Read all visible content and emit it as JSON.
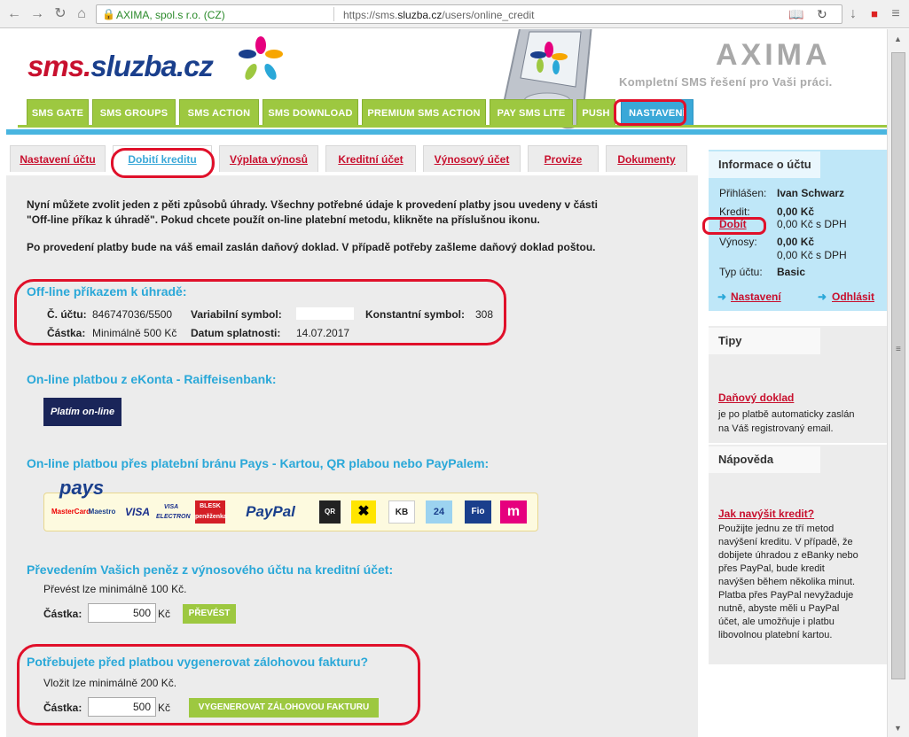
{
  "browser": {
    "org": "AXIMA, spol.s r.o. (CZ)",
    "url_prefix": "https://sms.",
    "url_domain": "sluzba.cz",
    "url_path": "/users/online_credit"
  },
  "header": {
    "logo_part1": "sms.",
    "logo_part2": "sluzba.cz",
    "brand": "AXIMA",
    "slogan": "Kompletní SMS řešení pro Vaši práci."
  },
  "nav": {
    "tabs": [
      "SMS GATE",
      "SMS GROUPS",
      "SMS ACTION",
      "SMS DOWNLOAD",
      "PREMIUM SMS ACTION",
      "PAY SMS LITE",
      "PUSH",
      "NASTAVENÍ"
    ],
    "active": "NASTAVENÍ"
  },
  "subnav": {
    "tabs": [
      "Nastavení účtu",
      "Dobití kreditu",
      "Výplata výnosů",
      "Kreditní účet",
      "Výnosový účet",
      "Provize",
      "Dokumenty"
    ],
    "active": "Dobití kreditu"
  },
  "main": {
    "intro1": "Nyní můžete zvolit jeden z pěti způsobů úhrady. Všechny potřebné údaje k provedení platby jsou uvedeny v části",
    "intro2": "\"Off-line příkaz k úhradě\". Pokud chcete použít on-line platební metodu, klikněte na příslušnou ikonu.",
    "intro3": "Po provedení platby bude na váš email zaslán daňový doklad. V případě potřeby zašleme daňový doklad poštou.",
    "offline": {
      "title": "Off-line příkazem k úhradě:",
      "account_label": "Č. účtu:",
      "account_value": "846747036/5500",
      "vs_label": "Variabilní symbol:",
      "ks_label": "Konstantní symbol:",
      "ks_value": "308",
      "amount_label": "Částka:",
      "amount_value": "Minimálně 500 Kč",
      "due_label": "Datum splatnosti:",
      "due_value": "14.07.2017"
    },
    "ekonto": {
      "title": "On-line platbou z eKonta - Raiffeisenbank:",
      "button": "Platím on-line"
    },
    "pays": {
      "title": "On-line platbou přes platební bránu Pays - Kartou, QR plabou nebo PayPalem:",
      "logo": "pays",
      "methods": [
        "MasterCard",
        "Maestro",
        "VISA",
        "VISA ELECTRON",
        "BLESK peněženka",
        "PayPal",
        "QR",
        "Raiffeisen",
        "KB",
        "24",
        "Fio",
        "m"
      ]
    },
    "transfer": {
      "title": "Převedením Vašich peněz z výnosového účtu na kreditní účet:",
      "note": "Převést lze minimálně 100 Kč.",
      "amount_label": "Částka:",
      "amount_value": "500",
      "currency": "Kč",
      "button": "PŘEVÉST"
    },
    "invoice": {
      "title": "Potřebujete před platbou vygenerovat zálohovou fakturu?",
      "note": "Vložit lze minimálně 200 Kč.",
      "amount_label": "Částka:",
      "amount_value": "500",
      "currency": "Kč",
      "button": "VYGENEROVAT ZÁLOHOVOU FAKTURU"
    }
  },
  "sidebar": {
    "info": {
      "title": "Informace o účtu",
      "logged_label": "Přihlášen:",
      "logged_value": "Ivan Schwarz",
      "credit_label": "Kredit:",
      "credit_value": "0,00 Kč",
      "topup_link": "Dobít",
      "credit_vat": "0,00 Kč s DPH",
      "yield_label": "Výnosy:",
      "yield_value": "0,00 Kč",
      "yield_vat": "0,00 Kč s DPH",
      "type_label": "Typ účtu:",
      "type_value": "Basic",
      "settings_link": "Nastavení",
      "logout_link": "Odhlásit"
    },
    "tips": {
      "title": "Tipy",
      "link": "Daňový doklad",
      "text": [
        "je po platbě automaticky zaslán",
        "na Váš registrovaný email."
      ]
    },
    "help": {
      "title": "Nápověda",
      "link": "Jak navýšit kredit?",
      "text": [
        "Použijte jednu ze tří metod",
        "navýšení kreditu. V případě, že",
        "dobijete úhradou z eBanky nebo",
        "přes PayPal, bude kredit",
        "navýšen během několika minut.",
        "Platba přes PayPal nevyžaduje",
        "nutně, abyste měli u PayPal",
        "účet, ale umožňuje i platbu",
        "libovolnou platební kartou."
      ]
    }
  }
}
